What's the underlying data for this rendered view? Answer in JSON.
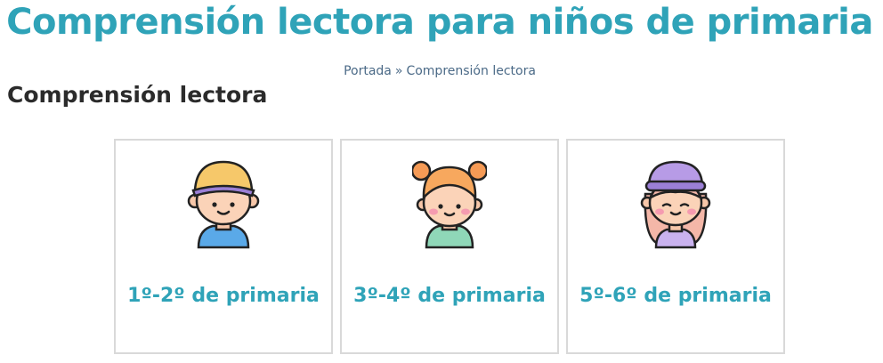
{
  "header": {
    "site_title": "Comprensión lectora para niños de primaria"
  },
  "breadcrumb": {
    "home": "Portada",
    "separator": "»",
    "current": "Comprensión lectora"
  },
  "page": {
    "title": "Comprensión lectora"
  },
  "cards": [
    {
      "label": "1º-2º de primaria",
      "icon": "boy-cap-icon"
    },
    {
      "label": "3º-4º de primaria",
      "icon": "girl-pigtails-icon"
    },
    {
      "label": "5º-6º de primaria",
      "icon": "girl-beanie-icon"
    }
  ]
}
